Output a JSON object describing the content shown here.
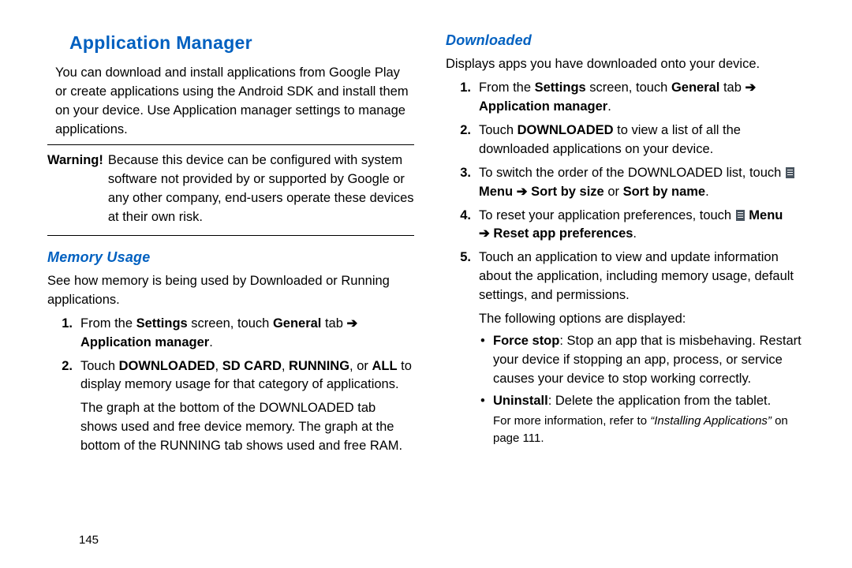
{
  "page_number": "145",
  "left": {
    "title": "Application Manager",
    "intro": "You can download and install applications from Google Play or create applications using the Android SDK and install them on your device. Use Application manager settings to manage applications.",
    "warning_label": "Warning!",
    "warning_text": "Because this device can be configured with system software not provided by or supported by Google or any other company, end-users operate these devices at their own risk.",
    "memory_title": "Memory Usage",
    "memory_intro": "See how memory is being used by Downloaded or Running applications.",
    "arrow": "➔",
    "steps": [
      {
        "num": "1.",
        "pre": "From the ",
        "b1": "Settings",
        "mid1": " screen, touch ",
        "b2": "General",
        "mid2": " tab ",
        "b3": "Application manager",
        "end": "."
      },
      {
        "num": "2.",
        "pre": "Touch ",
        "b1": "DOWNLOADED",
        "sep1": ", ",
        "b2": "SD CARD",
        "sep2": ", ",
        "b3": "RUNNING",
        "sep3": ", or ",
        "b4": "ALL",
        "end": " to display memory usage for that category of applications.",
        "para2": "The graph at the bottom of the DOWNLOADED tab shows used and free device memory. The graph at the bottom of the RUNNING tab shows used and free RAM."
      }
    ]
  },
  "right": {
    "title": "Downloaded",
    "intro": "Displays apps you have downloaded onto your device.",
    "arrow": "➔",
    "steps": [
      {
        "num": "1.",
        "pre": "From the ",
        "b1": "Settings",
        "mid1": " screen, touch ",
        "b2": "General",
        "mid2": " tab ",
        "b3": "Application manager",
        "end": "."
      },
      {
        "num": "2.",
        "pre": "Touch ",
        "b1": "DOWNLOADED",
        "end": " to view a list of all the downloaded applications on your device."
      },
      {
        "num": "3.",
        "pre": "To switch the order of the DOWNLOADED list, touch ",
        "b1": "Menu",
        "b2": "Sort by size",
        "mid": " or ",
        "b3": "Sort by name",
        "end": "."
      },
      {
        "num": "4.",
        "pre": "To reset your application preferences, touch ",
        "b1": "Menu",
        "b2": "Reset app preferences",
        "end": "."
      },
      {
        "num": "5.",
        "text": "Touch an application to view and update information about the application, including memory usage, default settings, and permissions."
      }
    ],
    "following": "The following options are displayed:",
    "bullets": [
      {
        "label": "Force stop",
        "text": ": Stop an app that is misbehaving. Restart your device if stopping an app, process, or service causes your device to stop working correctly."
      },
      {
        "label": "Uninstall",
        "text": ": Delete the application from the tablet."
      }
    ],
    "moreinfo_pre": "For more information, refer to ",
    "moreinfo_ref": "“Installing Applications”",
    "moreinfo_post": " on page 111."
  }
}
